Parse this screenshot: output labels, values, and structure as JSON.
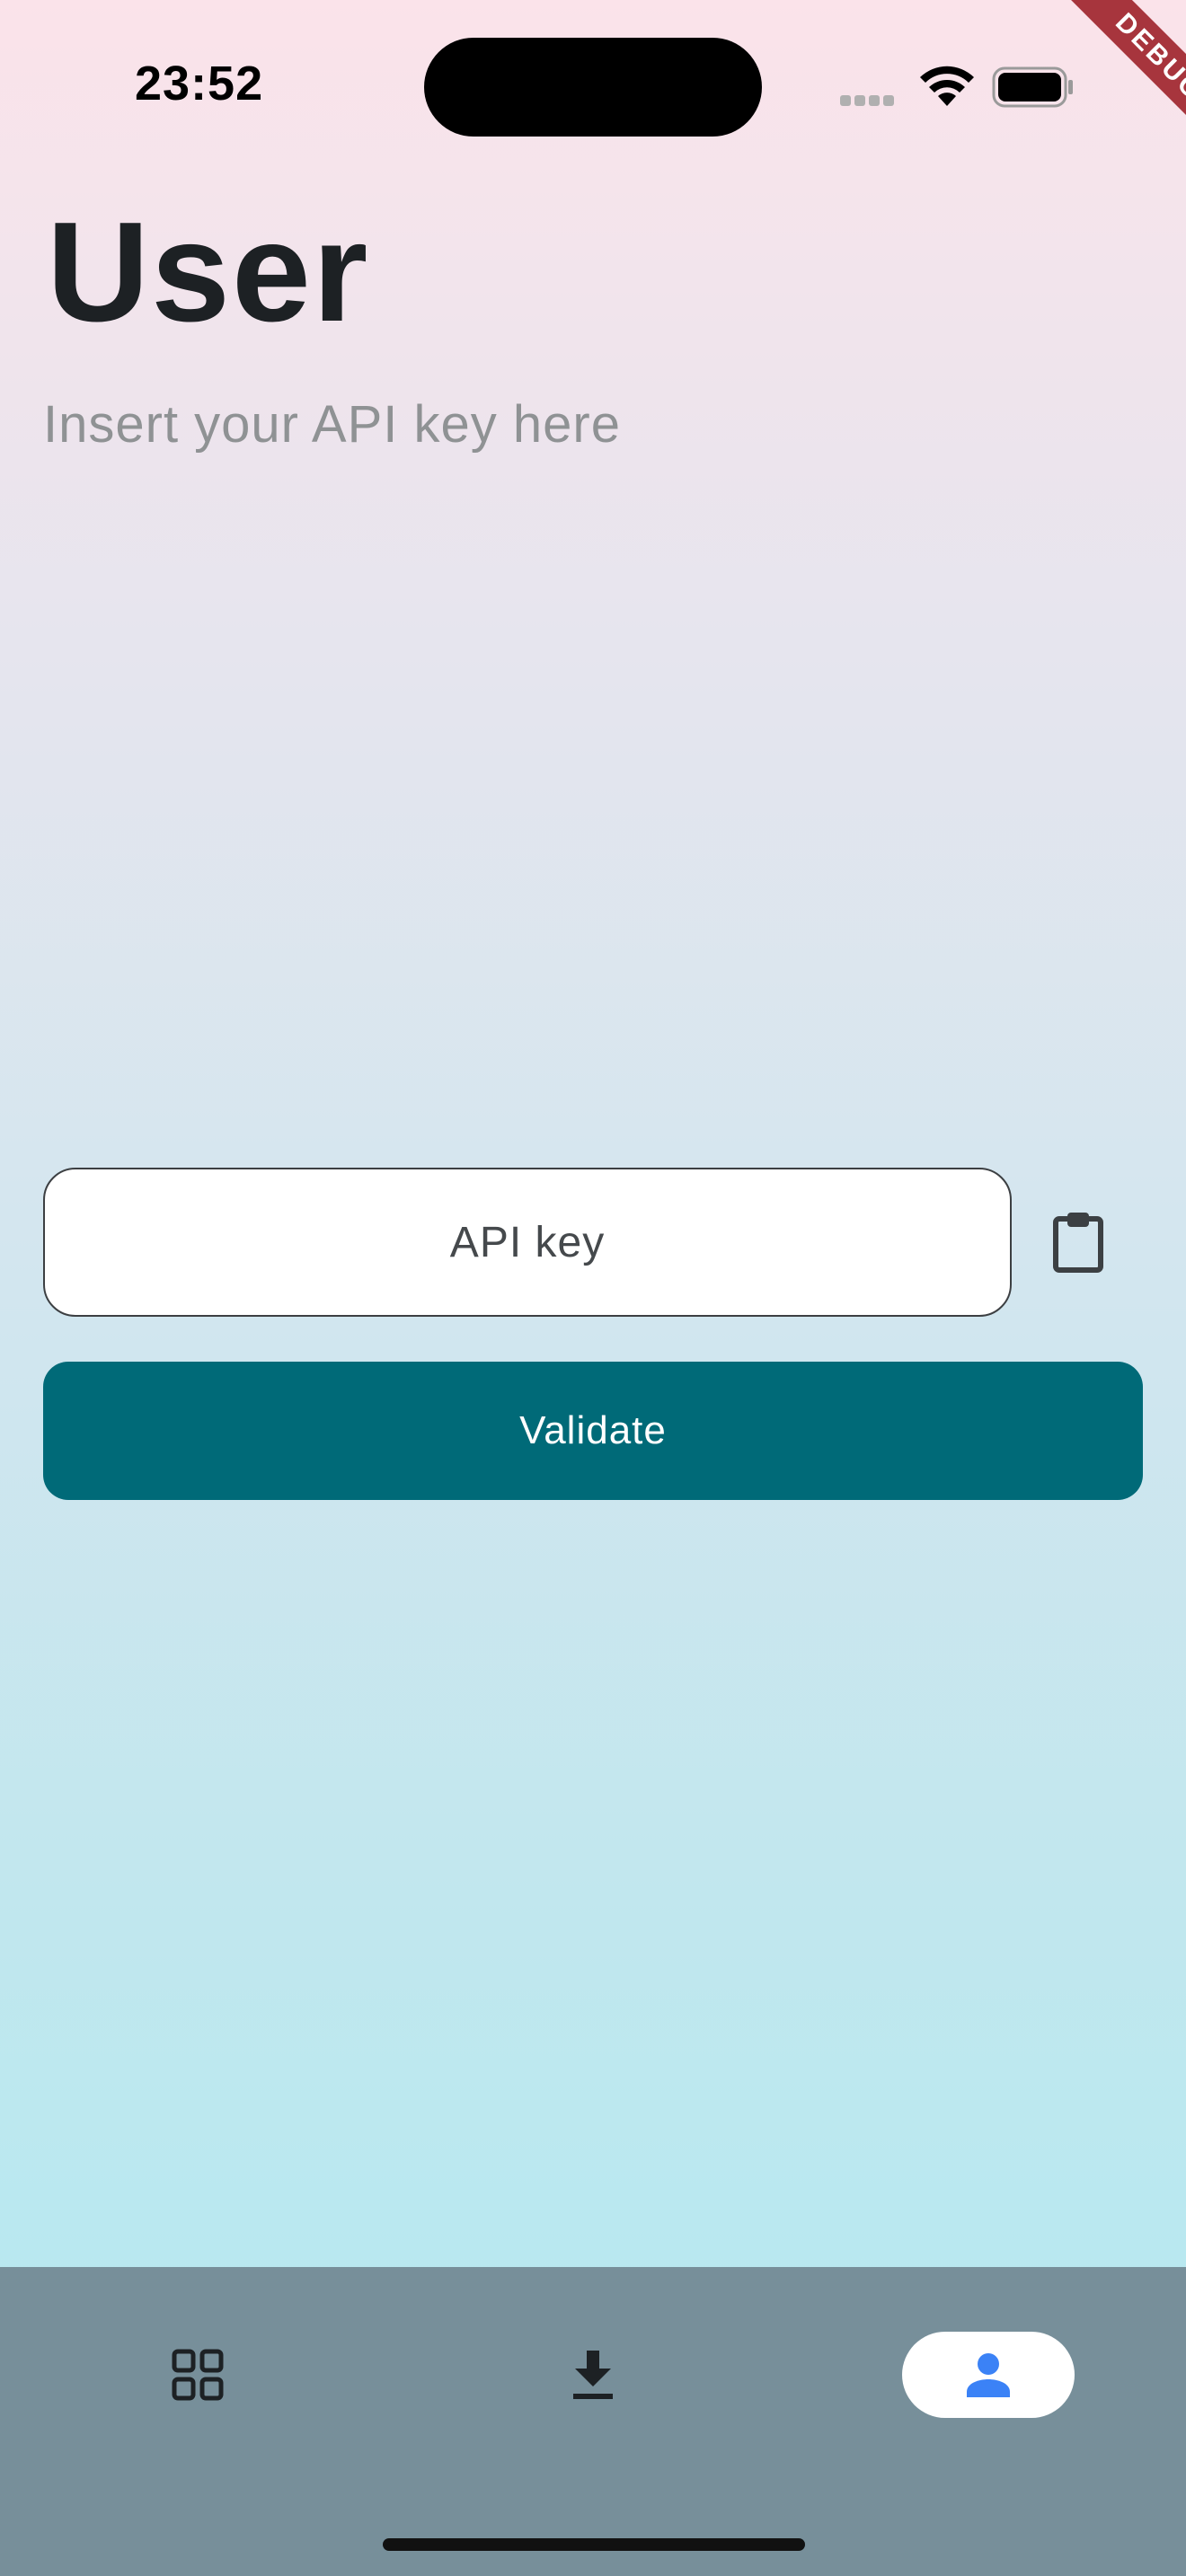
{
  "status_bar": {
    "time": "23:52",
    "icons": [
      "cellular-signal-icon",
      "wifi-icon",
      "battery-icon"
    ]
  },
  "debug_banner": {
    "label": "DEBUG"
  },
  "page": {
    "title": "User",
    "subtitle": "Insert your API key here"
  },
  "api_key_field": {
    "placeholder": "API key",
    "value": ""
  },
  "paste_button": {
    "icon": "clipboard-icon"
  },
  "validate_button": {
    "label": "Validate"
  },
  "bottom_nav": {
    "items": [
      {
        "icon": "grid-icon",
        "active": false
      },
      {
        "icon": "download-icon",
        "active": false
      },
      {
        "icon": "person-icon",
        "active": true
      }
    ]
  },
  "colors": {
    "primary": "#006a78",
    "nav_background": "#778f9a",
    "active_icon": "#3b82f6",
    "debug_ribbon": "#a7353d"
  }
}
